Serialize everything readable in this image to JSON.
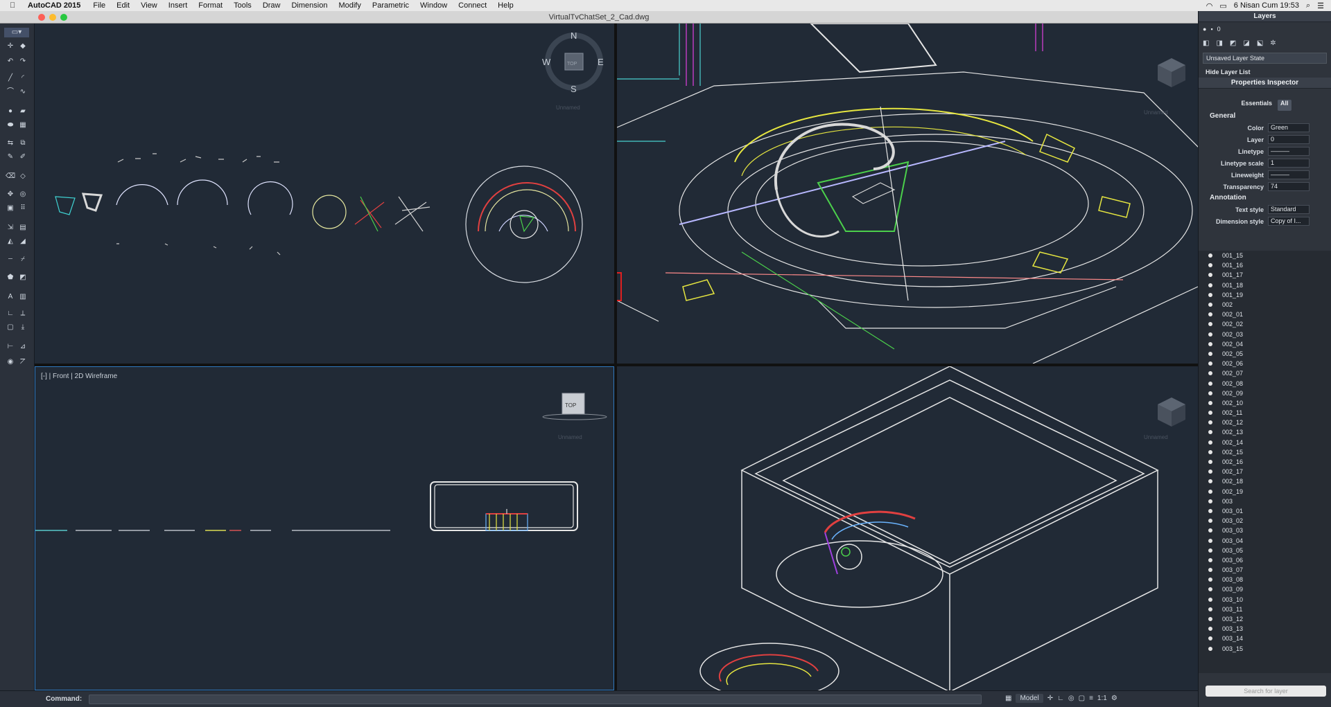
{
  "menubar": {
    "app": "AutoCAD 2015",
    "items": [
      "File",
      "Edit",
      "View",
      "Insert",
      "Format",
      "Tools",
      "Draw",
      "Dimension",
      "Modify",
      "Parametric",
      "Window",
      "Connect",
      "Help"
    ],
    "clock": "6 Nisan Cum 19:53"
  },
  "window": {
    "title": "VirtualTvChatSet_2_Cad.dwg"
  },
  "viewports": {
    "top_left_label": "",
    "bottom_left_label": "[-] | Front | 2D Wireframe",
    "compass": {
      "n": "N",
      "s": "S",
      "e": "E",
      "w": "W",
      "center": "TOP"
    },
    "cube_label": "TOP",
    "unnamed": "Unnamed"
  },
  "command": {
    "label": "Command:",
    "value": ""
  },
  "status": {
    "model": "Model",
    "scale": "1:1"
  },
  "panel": {
    "layers_title": "Layers",
    "current_layer": "0",
    "layer_state": "Unsaved Layer State",
    "hide_layer_list": "Hide Layer List",
    "inspector_title": "Properties Inspector",
    "tabs": [
      "Essentials",
      "All"
    ],
    "general_label": "General",
    "properties": [
      {
        "label": "Color",
        "value": "Green"
      },
      {
        "label": "Layer",
        "value": "0"
      },
      {
        "label": "Linetype",
        "value": "———"
      },
      {
        "label": "Linetype scale",
        "value": "1"
      },
      {
        "label": "Lineweight",
        "value": "———"
      },
      {
        "label": "Transparency",
        "value": "74"
      }
    ],
    "annotation_label": "Annotation",
    "annotation": [
      {
        "label": "Text style",
        "value": "Standard"
      },
      {
        "label": "Dimension style",
        "value": "Copy of I..."
      }
    ],
    "layers": [
      "001_15",
      "001_16",
      "001_17",
      "001_18",
      "001_19",
      "002",
      "002_01",
      "002_02",
      "002_03",
      "002_04",
      "002_05",
      "002_06",
      "002_07",
      "002_08",
      "002_09",
      "002_10",
      "002_11",
      "002_12",
      "002_13",
      "002_14",
      "002_15",
      "002_16",
      "002_17",
      "002_18",
      "002_19",
      "003",
      "003_01",
      "003_02",
      "003_03",
      "003_04",
      "003_05",
      "003_06",
      "003_07",
      "003_08",
      "003_09",
      "003_10",
      "003_11",
      "003_12",
      "003_13",
      "003_14",
      "003_15"
    ],
    "search_placeholder": "Search for layer"
  }
}
